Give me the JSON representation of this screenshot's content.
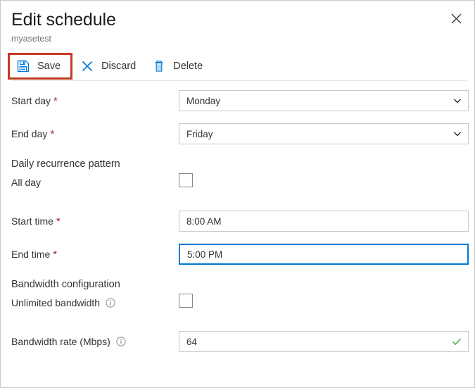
{
  "header": {
    "title": "Edit schedule",
    "subtitle": "myasetest",
    "close_icon": "close-icon"
  },
  "toolbar": {
    "save_label": "Save",
    "save_icon": "save-floppy-icon",
    "discard_label": "Discard",
    "discard_icon": "close-x-icon",
    "delete_label": "Delete",
    "delete_icon": "trash-icon",
    "highlight_color": "#c23b22"
  },
  "form": {
    "start_day": {
      "label": "Start day",
      "required": true,
      "value": "Monday",
      "control": "dropdown"
    },
    "end_day": {
      "label": "End day",
      "required": true,
      "value": "Friday",
      "control": "dropdown"
    },
    "daily_recurrence_heading": "Daily recurrence pattern",
    "all_day": {
      "label": "All day",
      "checked": false,
      "control": "checkbox"
    },
    "start_time": {
      "label": "Start time",
      "required": true,
      "value": "8:00 AM",
      "control": "textbox",
      "focused": false
    },
    "end_time": {
      "label": "End time",
      "required": true,
      "value": "5:00 PM",
      "control": "textbox",
      "focused": true
    },
    "bandwidth_heading": "Bandwidth configuration",
    "unlimited_bandwidth": {
      "label": "Unlimited bandwidth",
      "checked": false,
      "control": "checkbox",
      "info_icon": "info-icon"
    },
    "bandwidth_rate": {
      "label": "Bandwidth rate (Mbps)",
      "value": "64",
      "control": "textbox",
      "info_icon": "info-icon",
      "validation": "valid",
      "validation_icon": "green-checkmark-icon"
    }
  },
  "colors": {
    "accent": "#0078d4",
    "required_asterisk": "#a4262c",
    "valid_green": "#5ab552",
    "highlight_red": "#c23b22",
    "border_gray": "#c8c8c8"
  }
}
